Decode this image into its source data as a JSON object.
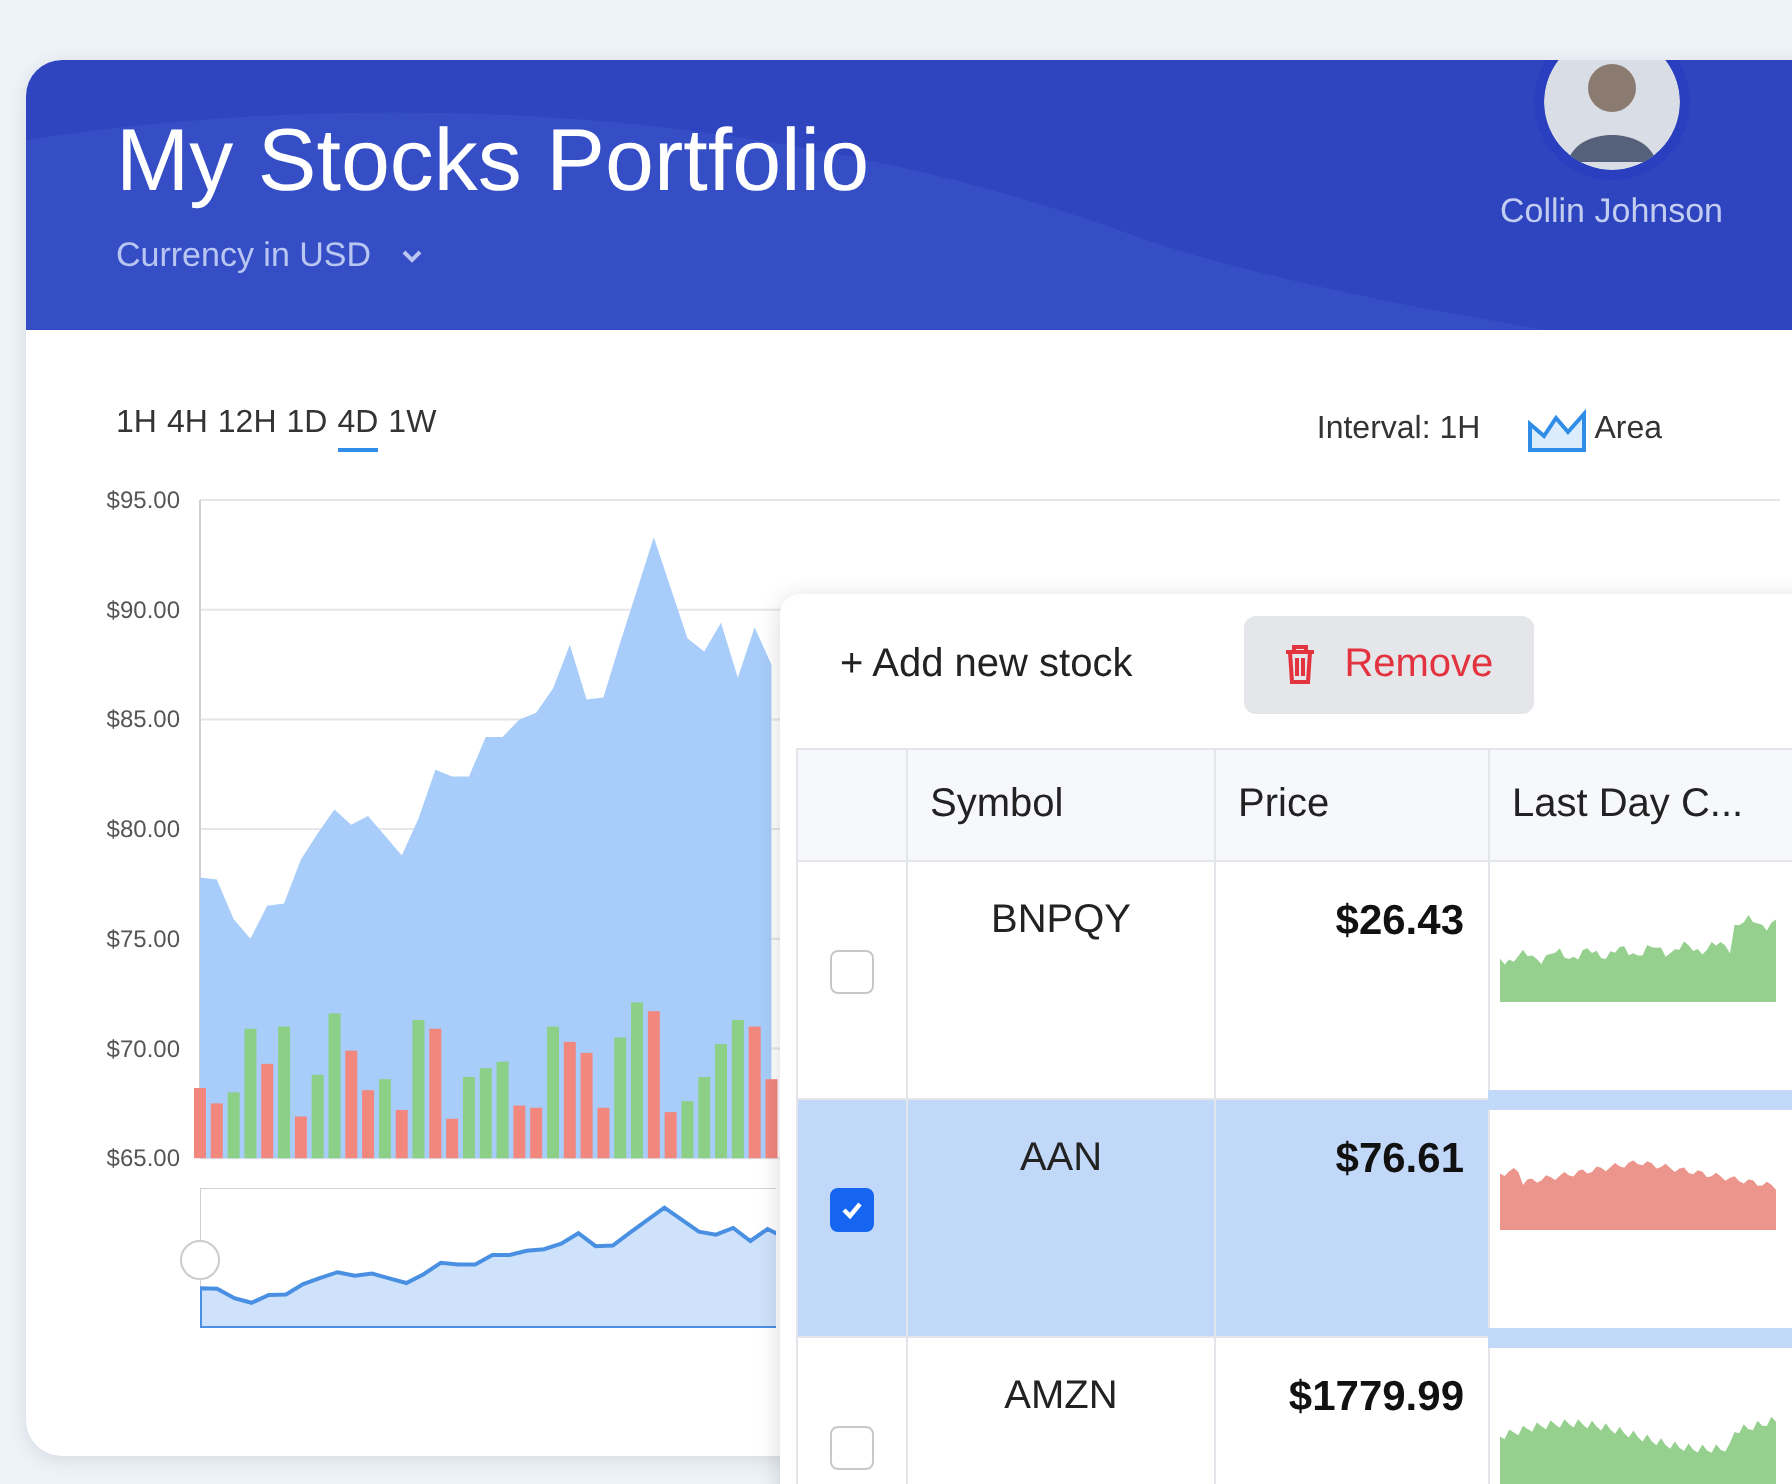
{
  "header": {
    "title": "My Stocks Portfolio",
    "currency": "Currency in USD",
    "user_name": "Collin Johnson"
  },
  "range_tabs": [
    {
      "label": "1H",
      "selected": false
    },
    {
      "label": "4H",
      "selected": false
    },
    {
      "label": "12H",
      "selected": false
    },
    {
      "label": "1D",
      "selected": false
    },
    {
      "label": "4D",
      "selected": true
    },
    {
      "label": "1W",
      "selected": false
    }
  ],
  "interval": "Interval: 1H",
  "chart_type": "Area",
  "chart_data": {
    "type": "area",
    "grid": true,
    "ylim": [
      65,
      95
    ],
    "yticks": [
      {
        "value": 65,
        "label": "$65.00"
      },
      {
        "value": 70,
        "label": "$70.00"
      },
      {
        "value": 75,
        "label": "$75.00"
      },
      {
        "value": 80,
        "label": "$80.00"
      },
      {
        "value": 85,
        "label": "$85.00"
      },
      {
        "value": 90,
        "label": "$90.00"
      },
      {
        "value": 95,
        "label": "$95.00"
      }
    ],
    "series": [
      {
        "type": "area",
        "color": "#a8cdfa",
        "values": [
          77.8,
          77.7,
          75.9,
          75.0,
          76.5,
          76.6,
          78.6,
          79.8,
          80.9,
          80.2,
          80.6,
          79.7,
          78.8,
          80.5,
          82.7,
          82.4,
          82.4,
          84.2,
          84.2,
          85.0,
          85.3,
          86.4,
          88.4,
          85.9,
          86.0,
          88.5,
          90.9,
          93.3,
          91.0,
          88.7,
          88.1,
          89.4,
          86.9,
          89.2,
          87.5,
          null,
          null,
          null,
          null,
          null,
          null,
          null,
          null,
          null,
          null,
          null,
          null,
          null,
          null,
          null,
          null,
          null,
          null,
          null,
          null,
          null,
          null,
          null,
          null,
          null,
          null,
          null,
          null,
          null,
          null,
          null,
          null,
          null,
          null,
          null,
          null,
          null,
          null,
          null,
          null,
          null,
          null,
          null,
          null,
          null,
          null,
          null,
          null,
          null,
          null,
          null,
          null,
          null,
          null,
          null,
          null,
          null,
          null,
          null,
          null
        ]
      },
      {
        "type": "bar",
        "color": "#8ccf86",
        "values": [
          null,
          null,
          68.0,
          70.9,
          null,
          71.0,
          null,
          68.8,
          71.6,
          null,
          null,
          68.6,
          null,
          71.3,
          null,
          null,
          68.7,
          69.1,
          69.4,
          null,
          null,
          71.0,
          null,
          null,
          null,
          70.5,
          72.1,
          null,
          null,
          67.6,
          68.7,
          70.2,
          71.3,
          null,
          null,
          null,
          null,
          null,
          null,
          null,
          null,
          null,
          null,
          null,
          null,
          null,
          null,
          null,
          null,
          null,
          null,
          null,
          null,
          null,
          null,
          null,
          null,
          null,
          null,
          null,
          null,
          null,
          null,
          null,
          null,
          null,
          null,
          null,
          null,
          null,
          null,
          null,
          null,
          null,
          null,
          null,
          null,
          null,
          null,
          null,
          null,
          null,
          null,
          null,
          null,
          null,
          null,
          null,
          null,
          null,
          null,
          null,
          null,
          null,
          null
        ]
      },
      {
        "type": "bar",
        "color": "#f2877e",
        "values": [
          68.2,
          67.5,
          null,
          null,
          69.3,
          null,
          66.9,
          null,
          null,
          69.9,
          68.1,
          null,
          67.2,
          null,
          70.9,
          66.8,
          null,
          null,
          null,
          67.4,
          67.3,
          null,
          70.3,
          69.8,
          67.3,
          null,
          null,
          71.7,
          67.1,
          null,
          null,
          null,
          null,
          71.0,
          68.6,
          null,
          null,
          null,
          null,
          null,
          null,
          null,
          null,
          null,
          null,
          null,
          null,
          null,
          null,
          null,
          null,
          null,
          null,
          null,
          null,
          null,
          null,
          null,
          null,
          null,
          null,
          null,
          null,
          null,
          null,
          null,
          null,
          null,
          null,
          null,
          null,
          null,
          null,
          null,
          null,
          null,
          null,
          null,
          null,
          null,
          null,
          null,
          null,
          null,
          null,
          null,
          null,
          null,
          null,
          null,
          null,
          null,
          null,
          null,
          null
        ]
      }
    ]
  },
  "stock_panel": {
    "add_label": "+ Add new stock",
    "remove_label": "Remove",
    "columns": [
      "Symbol",
      "Price",
      "Last Day C..."
    ],
    "rows": [
      {
        "symbol": "BNPQY",
        "price": "$26.43",
        "selected": false,
        "color": "#96d08f"
      },
      {
        "symbol": "AAN",
        "price": "$76.61",
        "selected": true,
        "color": "#ec958d"
      },
      {
        "symbol": "AMZN",
        "price": "$1779.99",
        "selected": false,
        "color": "#96d08f"
      }
    ]
  }
}
